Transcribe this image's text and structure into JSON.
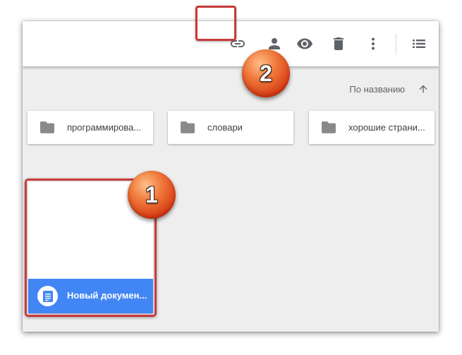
{
  "toolbar": {
    "buttons": [
      {
        "name": "link",
        "icon": "link-icon"
      },
      {
        "name": "share",
        "icon": "add-person-icon"
      },
      {
        "name": "preview",
        "icon": "eye-icon"
      },
      {
        "name": "delete",
        "icon": "trash-icon"
      },
      {
        "name": "more",
        "icon": "more-vert-icon"
      },
      {
        "name": "list-view",
        "icon": "list-view-icon"
      }
    ]
  },
  "sort": {
    "label": "По названию",
    "icon": "arrow-up-icon"
  },
  "folders": [
    {
      "name": "программирова..."
    },
    {
      "name": "словари"
    },
    {
      "name": "хорошие страни..."
    }
  ],
  "document": {
    "name": "Новый докумен...",
    "icon": "docs-icon"
  },
  "annotations": {
    "badge1": "1",
    "badge2": "2",
    "highlight_color": "#c9393b"
  },
  "colors": {
    "accent": "#4285f4",
    "icon_gray": "#5f6368",
    "badge": "#e0521e"
  }
}
